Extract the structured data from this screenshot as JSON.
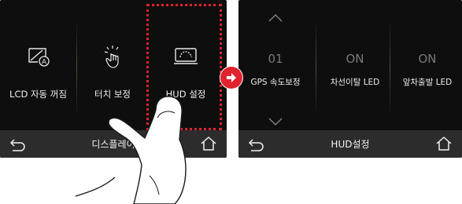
{
  "left_screen": {
    "tiles": [
      {
        "label": "LCD 자동 꺼짐",
        "icon": "lcd-auto-off-icon"
      },
      {
        "label": "터치 보정",
        "icon": "touch-calibration-icon"
      },
      {
        "label": "HUD 설정",
        "icon": "hud-settings-icon"
      }
    ],
    "bottom_bar": {
      "title": "디스플레이",
      "back_icon": "back-arrow-icon",
      "home_icon": "home-icon"
    }
  },
  "right_screen": {
    "settings": [
      {
        "value": "01",
        "label": "GPS 속도보정"
      },
      {
        "value": "ON",
        "label": "차선이탈 LED"
      },
      {
        "value": "ON",
        "label": "앞차출발 LED"
      }
    ],
    "bottom_bar": {
      "title": "HUD설정",
      "back_icon": "back-arrow-icon",
      "home_icon": "home-icon"
    }
  },
  "colors": {
    "highlight": "#e0232e",
    "screen_bg": "#0e0e0e",
    "bar_bg": "#2c2c2c"
  }
}
